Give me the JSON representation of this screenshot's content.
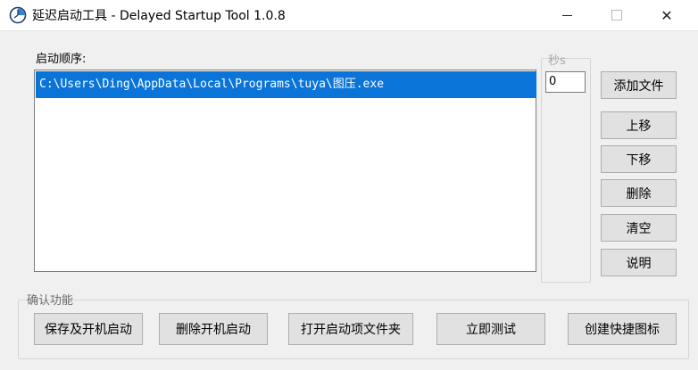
{
  "window": {
    "title": "延迟启动工具 - Delayed Startup Tool 1.0.8",
    "close_glyph": "✕"
  },
  "order_section": {
    "label": "启动顺序:",
    "items": [
      {
        "path": "C:\\Users\\Ding\\AppData\\Local\\Programs\\tuya\\图压.exe",
        "selected": true
      }
    ]
  },
  "seconds": {
    "label": "秒s",
    "value": "0"
  },
  "side_buttons": {
    "add_file": "添加文件",
    "move_up": "上移",
    "move_down": "下移",
    "delete": "删除",
    "clear": "清空",
    "help": "说明"
  },
  "confirm_section": {
    "label": "确认功能",
    "buttons": {
      "save_and_startup": "保存及开机启动",
      "remove_startup": "删除开机启动",
      "open_startup_folder": "打开启动项文件夹",
      "test_now": "立即测试",
      "create_shortcut": "创建快捷图标"
    }
  },
  "colors": {
    "selection": "#0a74d9",
    "window_bg": "#f0f0f0",
    "button_bg": "#e1e1e1"
  }
}
